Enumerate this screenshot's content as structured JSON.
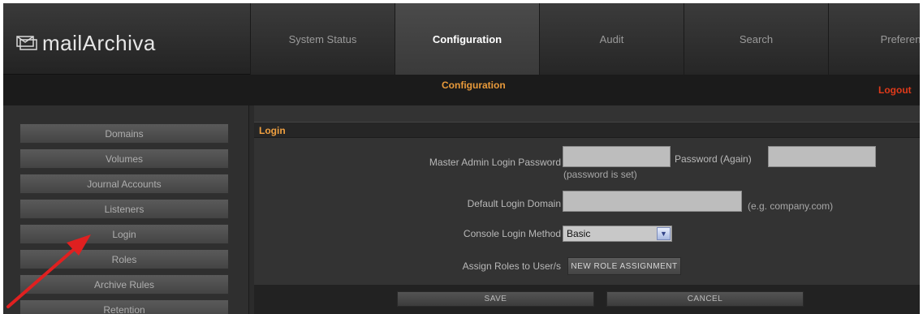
{
  "app": {
    "logo_text": "mailArchiva",
    "logo_icon": "envelope-icon"
  },
  "nav": {
    "tabs": [
      {
        "label": "System Status",
        "active": false
      },
      {
        "label": "Configuration",
        "active": true
      },
      {
        "label": "Audit",
        "active": false
      },
      {
        "label": "Search",
        "active": false
      },
      {
        "label": "Preferen",
        "active": false
      }
    ]
  },
  "subbar": {
    "title": "Configuration",
    "logout": "Logout"
  },
  "sidebar": {
    "items": [
      {
        "label": "Domains"
      },
      {
        "label": "Volumes"
      },
      {
        "label": "Journal Accounts"
      },
      {
        "label": "Listeners"
      },
      {
        "label": "Login"
      },
      {
        "label": "Roles"
      },
      {
        "label": "Archive Rules"
      },
      {
        "label": "Retention"
      }
    ]
  },
  "login": {
    "section_title": "Login",
    "master_password_label": "Master Admin Login Password",
    "master_password_value": "",
    "password_again_label": "Password (Again)",
    "password_again_value": "",
    "password_status": "(password is set)",
    "default_domain_label": "Default Login Domain",
    "default_domain_value": "",
    "default_domain_hint": "(e.g. company.com)",
    "login_method_label": "Console Login Method",
    "login_method_value": "Basic",
    "assign_roles_label": "Assign Roles to User/s",
    "new_role_button": "NEW ROLE ASSIGNMENT"
  },
  "footer": {
    "save": "SAVE",
    "cancel": "CANCEL"
  },
  "annotation": {
    "arrow_color": "#e02020"
  },
  "colors": {
    "accent": "#e99a3a",
    "logout": "#e03a1a"
  }
}
